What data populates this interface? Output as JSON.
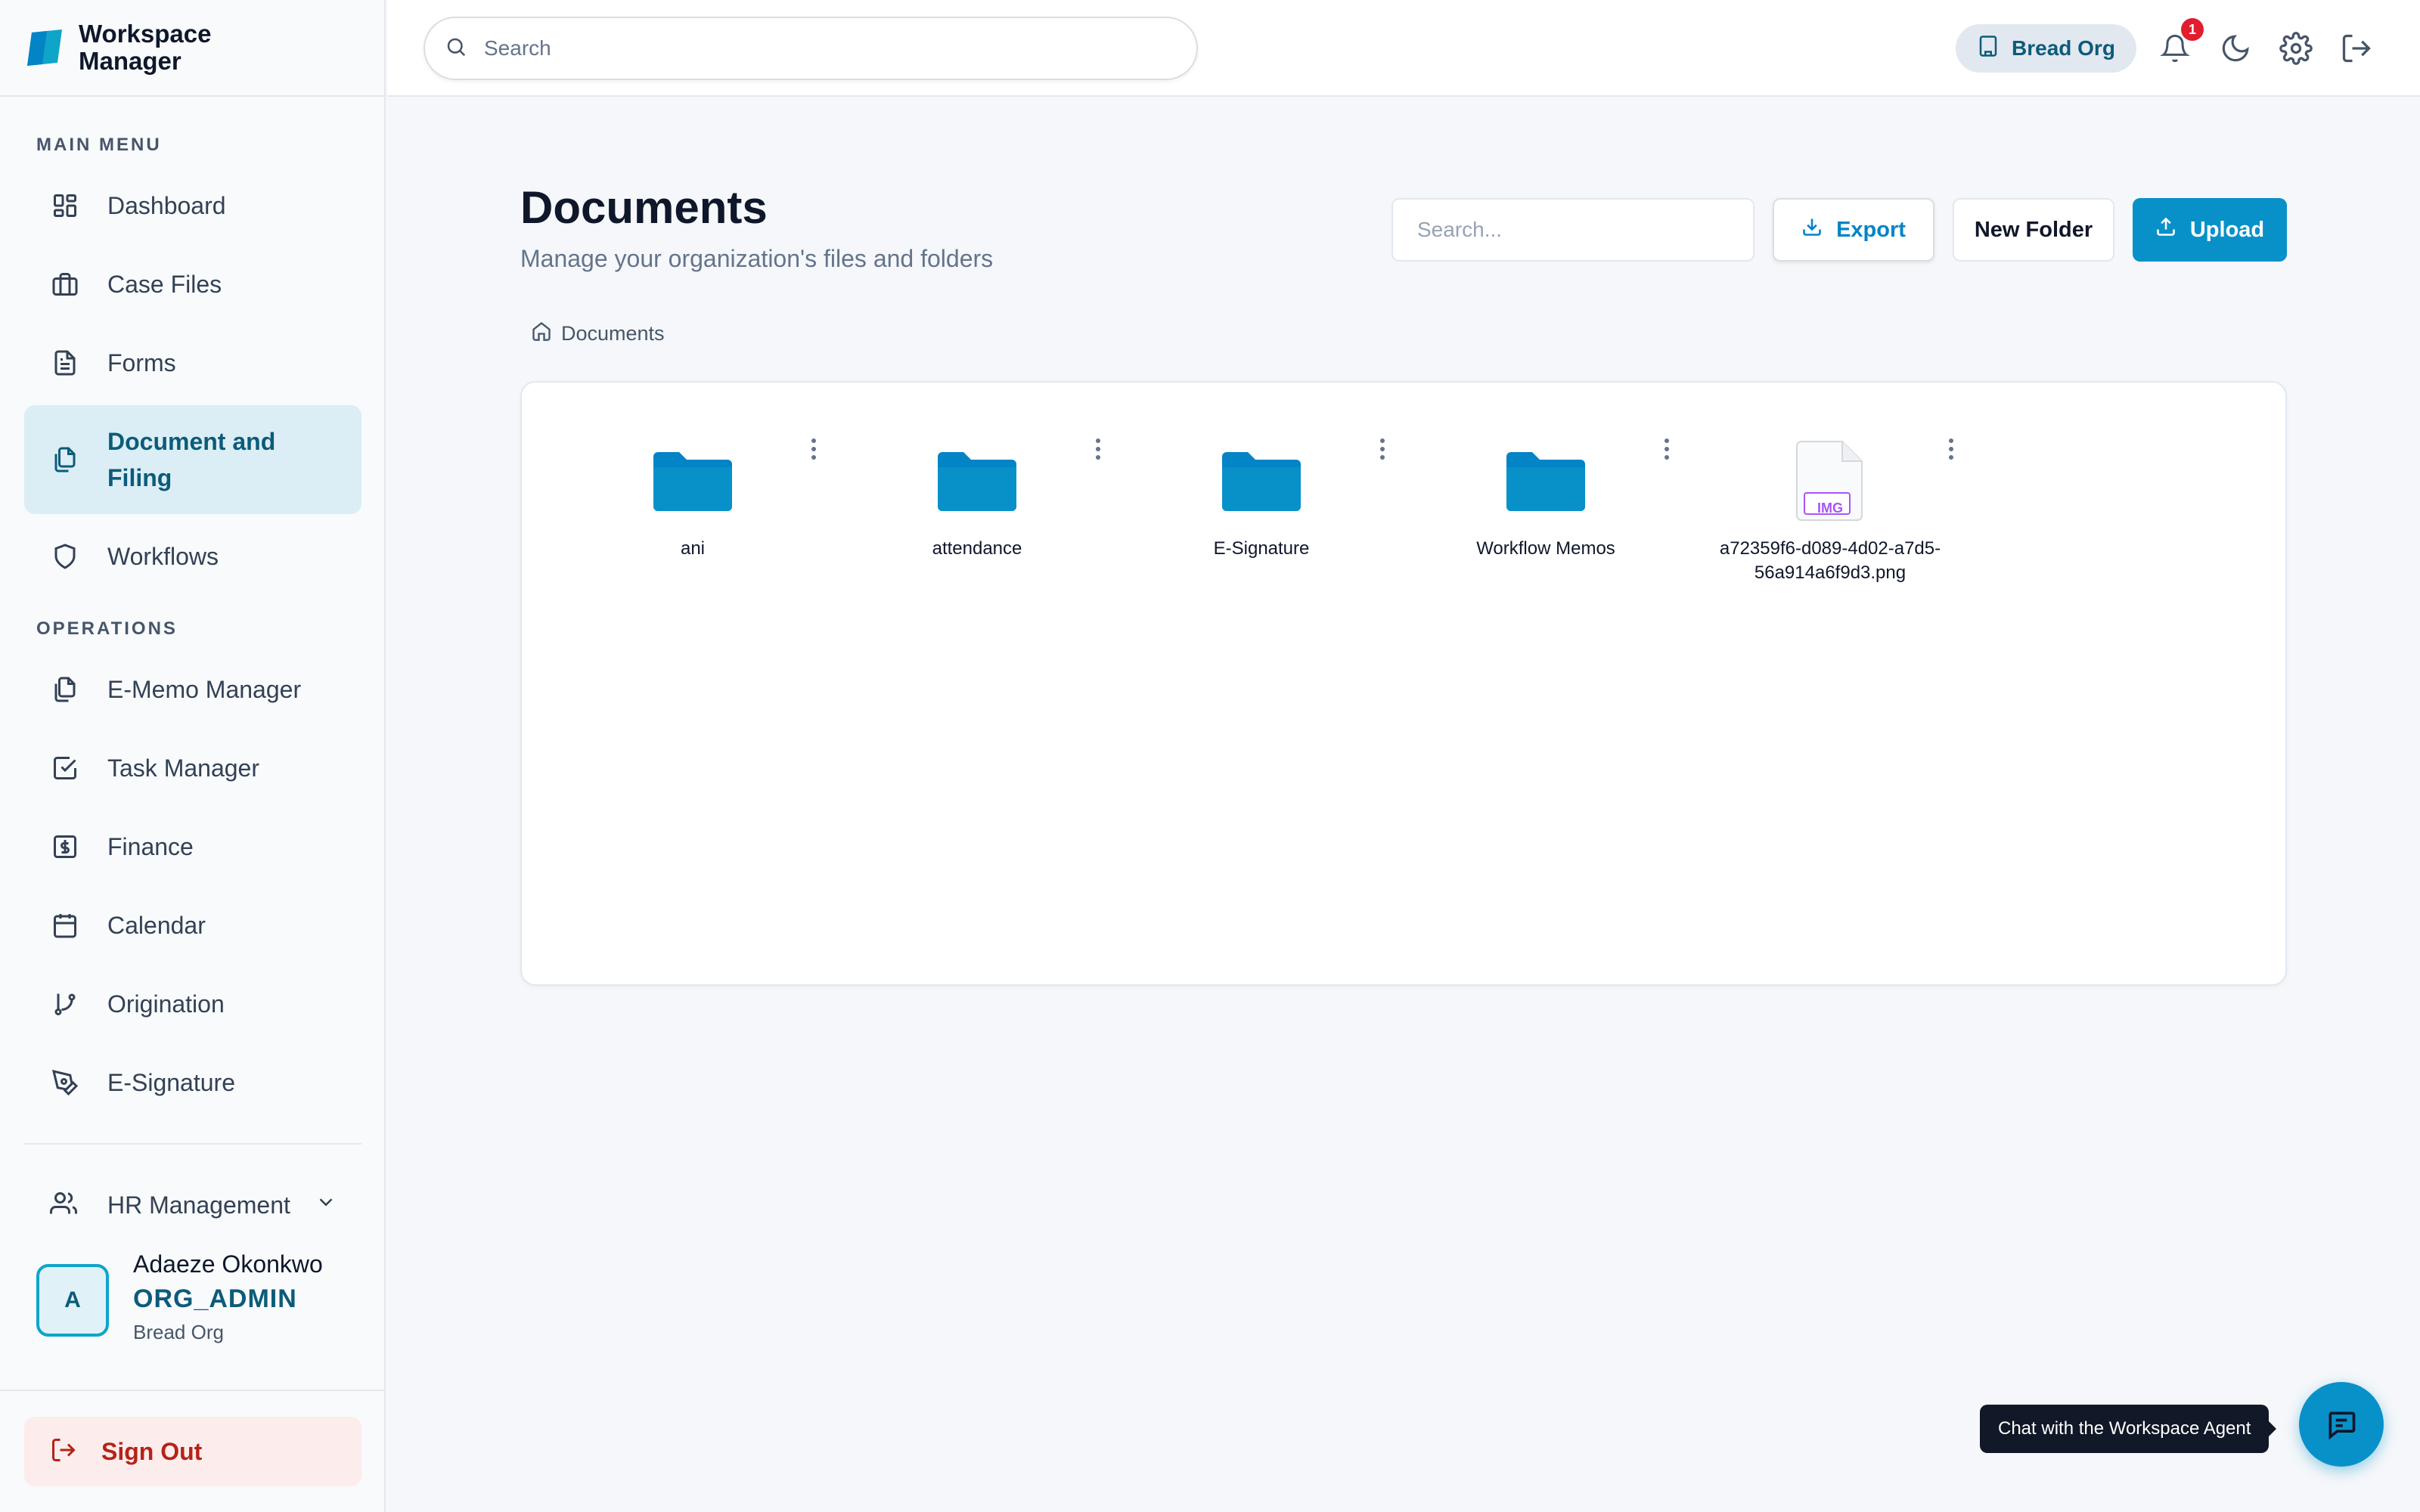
{
  "app": {
    "title": "Workspace\nManager"
  },
  "sidebar": {
    "main_menu_title": "MAIN MENU",
    "operations_title": "OPERATIONS",
    "main_items": [
      {
        "label": "Dashboard",
        "icon": "dashboard-icon"
      },
      {
        "label": "Case Files",
        "icon": "briefcase-icon"
      },
      {
        "label": "Forms",
        "icon": "file-text-icon"
      },
      {
        "label": "Document and Filing",
        "icon": "files-icon",
        "active": true
      },
      {
        "label": "Workflows",
        "icon": "shield-icon"
      }
    ],
    "ops_items": [
      {
        "label": "E-Memo Manager",
        "icon": "files-icon"
      },
      {
        "label": "Task Manager",
        "icon": "checkbox-icon"
      },
      {
        "label": "Finance",
        "icon": "dollar-icon"
      },
      {
        "label": "Calendar",
        "icon": "calendar-icon"
      },
      {
        "label": "Origination",
        "icon": "git-branch-icon"
      },
      {
        "label": "E-Signature",
        "icon": "pen-icon"
      }
    ],
    "hr_label": "HR Management",
    "user": {
      "initial": "A",
      "name": "Adaeze Okonkwo",
      "role": "ORG_ADMIN",
      "org": "Bread Org"
    },
    "signout_label": "Sign Out"
  },
  "topbar": {
    "search_placeholder": "Search",
    "org_label": "Bread Org",
    "notification_count": "1"
  },
  "main": {
    "title": "Documents",
    "subtitle": "Manage your organization's files and folders",
    "search_placeholder": "Search...",
    "export_label": "Export",
    "new_folder_label": "New Folder",
    "upload_label": "Upload",
    "breadcrumb": "Documents",
    "items": [
      {
        "name": "ani",
        "type": "folder"
      },
      {
        "name": "attendance",
        "type": "folder"
      },
      {
        "name": "E-Signature",
        "type": "folder"
      },
      {
        "name": "Workflow Memos",
        "type": "folder"
      },
      {
        "name": "a72359f6-d089-4d02-a7d5-56a914a6f9d3.png",
        "type": "image",
        "badge": "IMG"
      }
    ]
  },
  "chat": {
    "tooltip": "Chat with the Workspace Agent"
  },
  "colors": {
    "accent": "#0891c9",
    "active_bg": "#dbeef5",
    "active_text": "#0c5b7a",
    "danger": "#b42318"
  }
}
